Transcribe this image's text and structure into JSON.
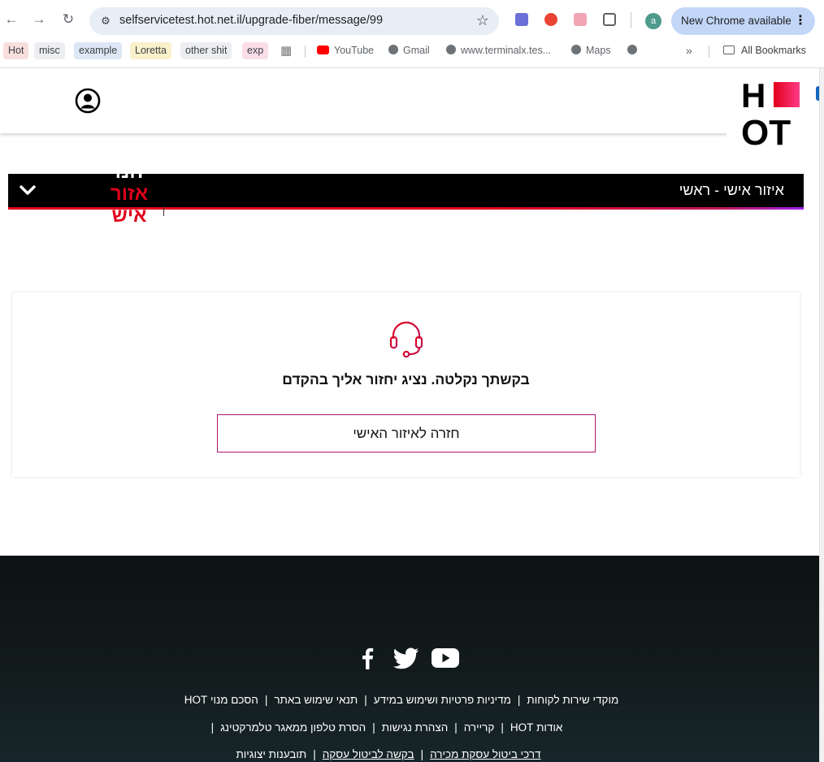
{
  "browser": {
    "url": "selfservicetest.hot.net.il/upgrade-fiber/message/99",
    "profile_initial": "a",
    "update_label": "New Chrome available",
    "bookmarks": {
      "chips": [
        "Hot",
        "misc",
        "example",
        "Loretta",
        "other shit",
        "exp"
      ],
      "links": [
        "YouTube",
        "Gmail",
        "www.terminalx.tes...",
        "Maps"
      ],
      "all_bookmarks": "All Bookmarks"
    }
  },
  "site": {
    "logo_lines": [
      "H",
      "OT"
    ],
    "bar_title": "איזור אישי - ראשי",
    "cut_text": [
      "חנו",
      "אזור",
      "איש"
    ]
  },
  "card": {
    "message": "בקשתך נקלטה. נציג יחזור אליך בהקדם",
    "button_label": "חזרה לאיזור האישי"
  },
  "footer": {
    "row1": [
      "מוקדי שירות לקוחות",
      "מדיניות פרטיות ושימוש במידע",
      "תנאי שימוש באתר",
      "הסכם מנוי HOT"
    ],
    "row2": [
      "אודות HOT",
      "קריירה",
      "הצהרת נגישות",
      "הסרת טלפון ממאגר טלמרקטינג"
    ],
    "row3": [
      "דרכי ביטול עסקת מכירה",
      "בקשה לביטול עסקה",
      "תובענות יצוגיות"
    ]
  },
  "colors": {
    "brand_red": "#e1001a",
    "brand_magenta": "#c2185b",
    "footer_bg": "#121b1c"
  }
}
